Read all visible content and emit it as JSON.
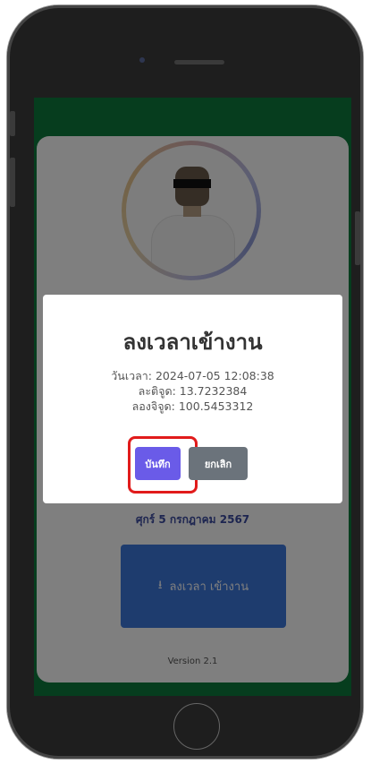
{
  "app": {
    "date_text": "ศุกร์ 5 กรกฎาคม 2567",
    "clock_in_label": "ลงเวลา เข้างาน",
    "clock_in_icon": "download-icon",
    "version": "Version 2.1"
  },
  "modal": {
    "title": "ลงเวลาเข้างาน",
    "datetime": "วันเวลา: 2024-07-05 12:08:38",
    "latitude": "ละติจูด: 13.7232384",
    "longitude": "ลองจิจูด: 100.5453312",
    "save_label": "บันทึก",
    "cancel_label": "ยกเลิก"
  },
  "colors": {
    "header_green": "#0c7a3c",
    "save_purple": "#6a5be8",
    "cancel_gray": "#6b737b",
    "clockin_blue": "#3d78dc",
    "highlight_red": "#e11b1b"
  }
}
